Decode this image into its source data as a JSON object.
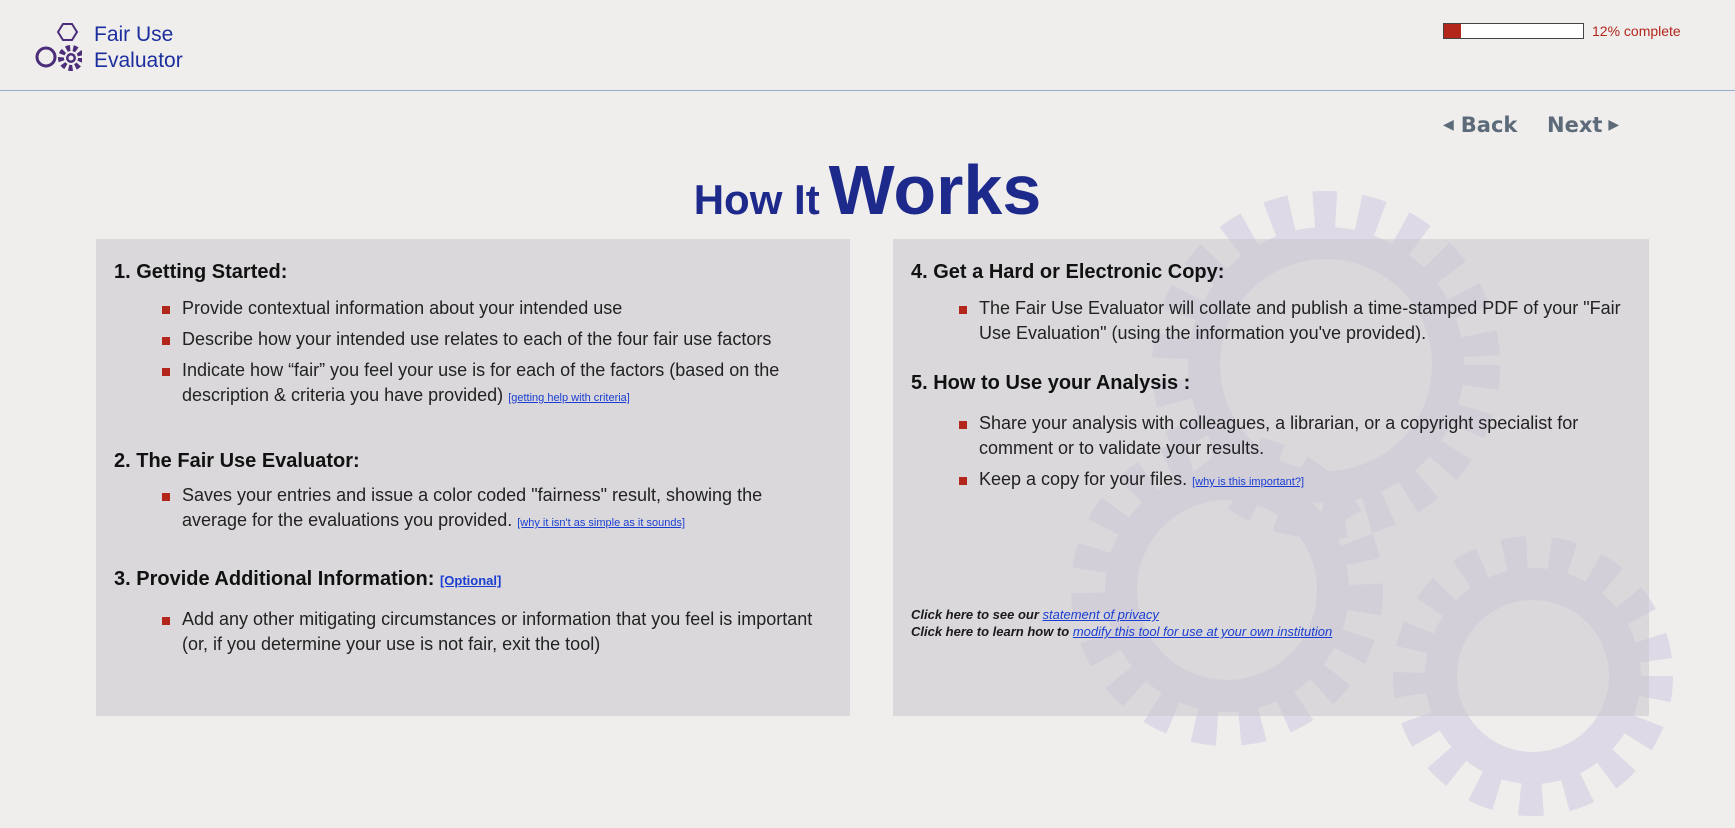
{
  "app": {
    "logo_line1": "Fair Use",
    "logo_line2": "Evaluator",
    "brand_color": "#1d2f9e",
    "accent_color": "#b3261c"
  },
  "progress": {
    "percent": 12,
    "label": "12% complete"
  },
  "nav": {
    "back_label": "Back",
    "next_label": "Next"
  },
  "page": {
    "title_part1": "How It",
    "title_part2": "Works"
  },
  "left_panel": {
    "sections": [
      {
        "heading": "1. Getting Started:",
        "items": [
          {
            "text": "Provide contextual information about your intended use"
          },
          {
            "text": "Describe how your intended use relates to each of the four fair use factors"
          },
          {
            "text": "Indicate how “fair” you feel your use is for each of the factors (based on the description & criteria you have provided)",
            "link": "[getting help with criteria]"
          }
        ]
      },
      {
        "heading": "2. The Fair Use Evaluator:",
        "items": [
          {
            "text": "Saves your entries and issue a color coded \"fairness\" result, showing the average for the evaluations you provided.",
            "link": "[why it isn't as simple as it sounds]"
          }
        ]
      },
      {
        "heading": "3. Provide Additional Information:",
        "heading_link": "[Optional]",
        "items": [
          {
            "text": "Add any other mitigating circumstances or information that you feel is important (or, if you determine your use is not fair, exit the tool)"
          }
        ]
      }
    ]
  },
  "right_panel": {
    "sections": [
      {
        "heading": "4. Get a Hard or Electronic Copy:",
        "items": [
          {
            "text": "The Fair Use Evaluator will collate and publish a time-stamped PDF of your \"Fair Use Evaluation\" (using the information you've provided)."
          }
        ]
      },
      {
        "heading": "5. How to Use your Analysis :",
        "items": [
          {
            "text": "Share your analysis with colleagues, a librarian, or a copyright specialist for comment or to validate your results."
          },
          {
            "text": "Keep a copy for your files.",
            "link": "[why is this important?]"
          }
        ]
      }
    ],
    "footer": {
      "privacy_prefix": "Click here to see our",
      "privacy_link": "statement of privacy",
      "modify_prefix": "Click here to learn how to",
      "modify_link": "modify this tool for use at your own institution"
    }
  }
}
